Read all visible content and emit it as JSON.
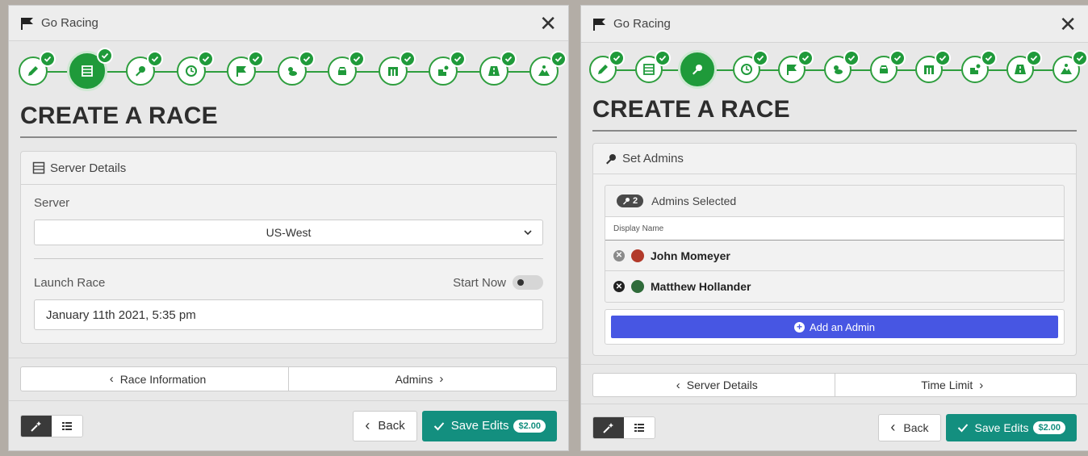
{
  "left": {
    "app_title": "Go Racing",
    "heading": "CREATE A RACE",
    "section_title": "Server Details",
    "server_label": "Server",
    "server_value": "US-West",
    "launch_label": "Launch Race",
    "start_now_label": "Start Now",
    "launch_value": "January 11th 2021, 5:35 pm",
    "nav_prev": "Race Information",
    "nav_next": "Admins",
    "back_label": "Back",
    "save_label": "Save Edits",
    "price": "$2.00"
  },
  "right": {
    "app_title": "Go Racing",
    "heading": "CREATE A RACE",
    "section_title": "Set Admins",
    "admin_count": "2",
    "admins_selected_label": "Admins Selected",
    "column_header": "Display Name",
    "admins": [
      {
        "name": "John Momeyer",
        "avatar_color": "#b23a2a"
      },
      {
        "name": "Matthew Hollander",
        "avatar_color": "#2f6b3a"
      }
    ],
    "add_admin_label": "Add an Admin",
    "nav_prev": "Server Details",
    "nav_next": "Time Limit",
    "back_label": "Back",
    "save_label": "Save Edits",
    "price": "$2.00"
  },
  "steps": [
    {
      "icon": "pencil-icon"
    },
    {
      "icon": "server-icon"
    },
    {
      "icon": "key-icon"
    },
    {
      "icon": "clock-icon"
    },
    {
      "icon": "flag-icon"
    },
    {
      "icon": "weather-icon"
    },
    {
      "icon": "car-icon"
    },
    {
      "icon": "track-icon"
    },
    {
      "icon": "wheel-icon"
    },
    {
      "icon": "road-icon"
    },
    {
      "icon": "mountain-icon"
    }
  ],
  "colors": {
    "accent_green": "#1f9a3a",
    "save_teal": "#138f7f",
    "add_blue": "#4756e3"
  }
}
